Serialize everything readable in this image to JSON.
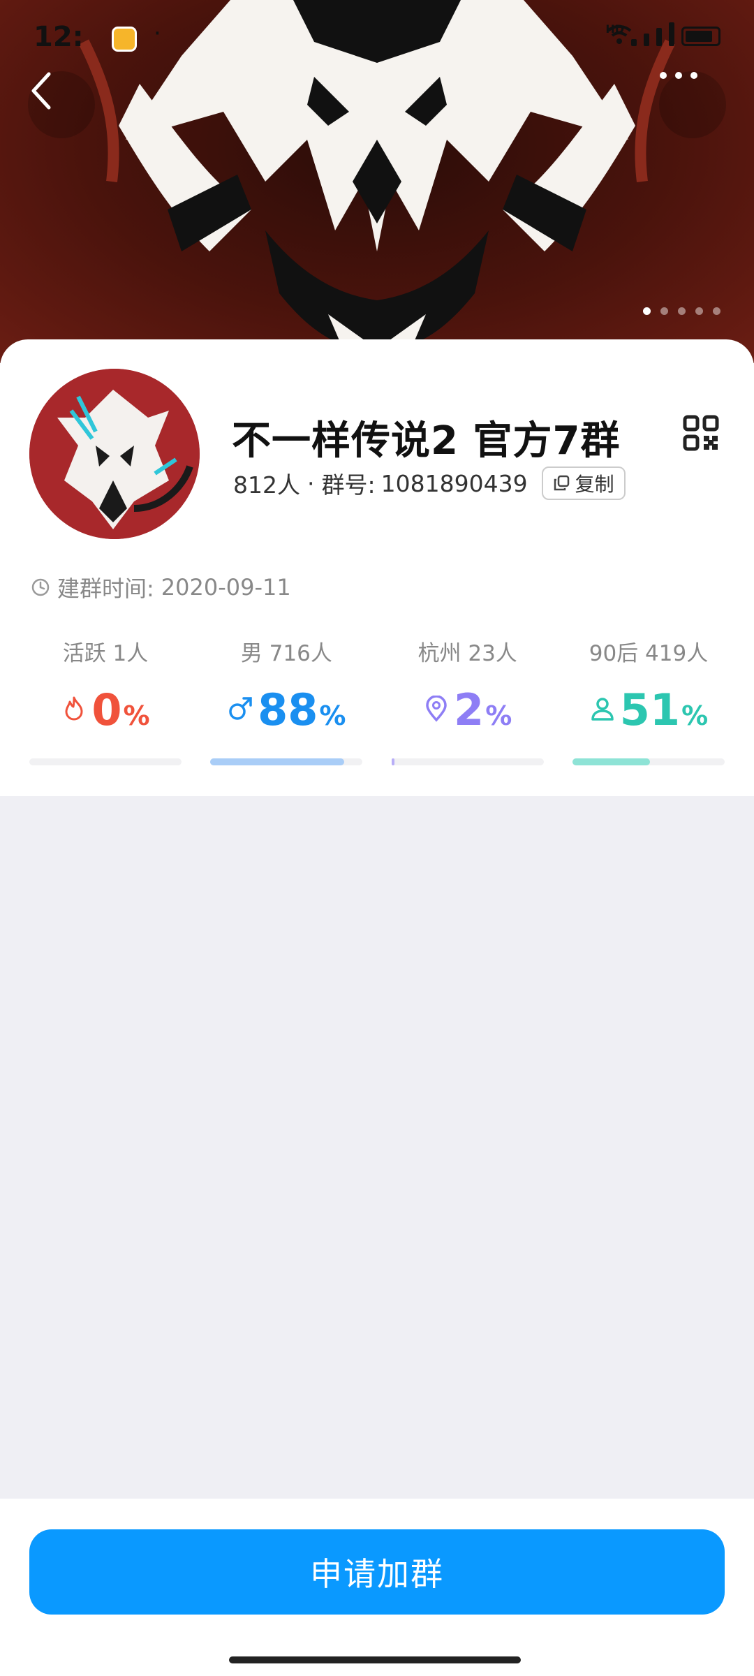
{
  "status_bar": {
    "time": "12:",
    "more": "·"
  },
  "header": {
    "hd_label": "HD"
  },
  "group": {
    "name": "不一样传说2 官方7群",
    "member_count": "812人",
    "separator": "·",
    "id_label": "群号:",
    "id_value": "1081890439",
    "copy_label": "复制",
    "created_label": "建群时间:",
    "created_value": "2020-09-11"
  },
  "stats": [
    {
      "label": "活跃 1人",
      "value": "0",
      "pct": "%",
      "icon": "flame-icon",
      "color": "#f0523b",
      "fill": 0.0
    },
    {
      "label": "男 716人",
      "value": "88",
      "pct": "%",
      "icon": "male-icon",
      "color": "#1a8ff0",
      "fill": 0.88,
      "bar_color": "#a9cdf7"
    },
    {
      "label": "杭州 23人",
      "value": "2",
      "pct": "%",
      "icon": "location-icon",
      "color": "#8e7ef5",
      "fill": 0.02,
      "bar_color": "#b8aef7"
    },
    {
      "label": "90后 419人",
      "value": "51",
      "pct": "%",
      "icon": "person-icon",
      "color": "#2cc6b0",
      "fill": 0.51,
      "bar_color": "#8ee3d6"
    }
  ],
  "join_button": {
    "label": "申请加群"
  },
  "colors": {
    "primary": "#0a99ff",
    "page_bg": "#efeff4"
  }
}
